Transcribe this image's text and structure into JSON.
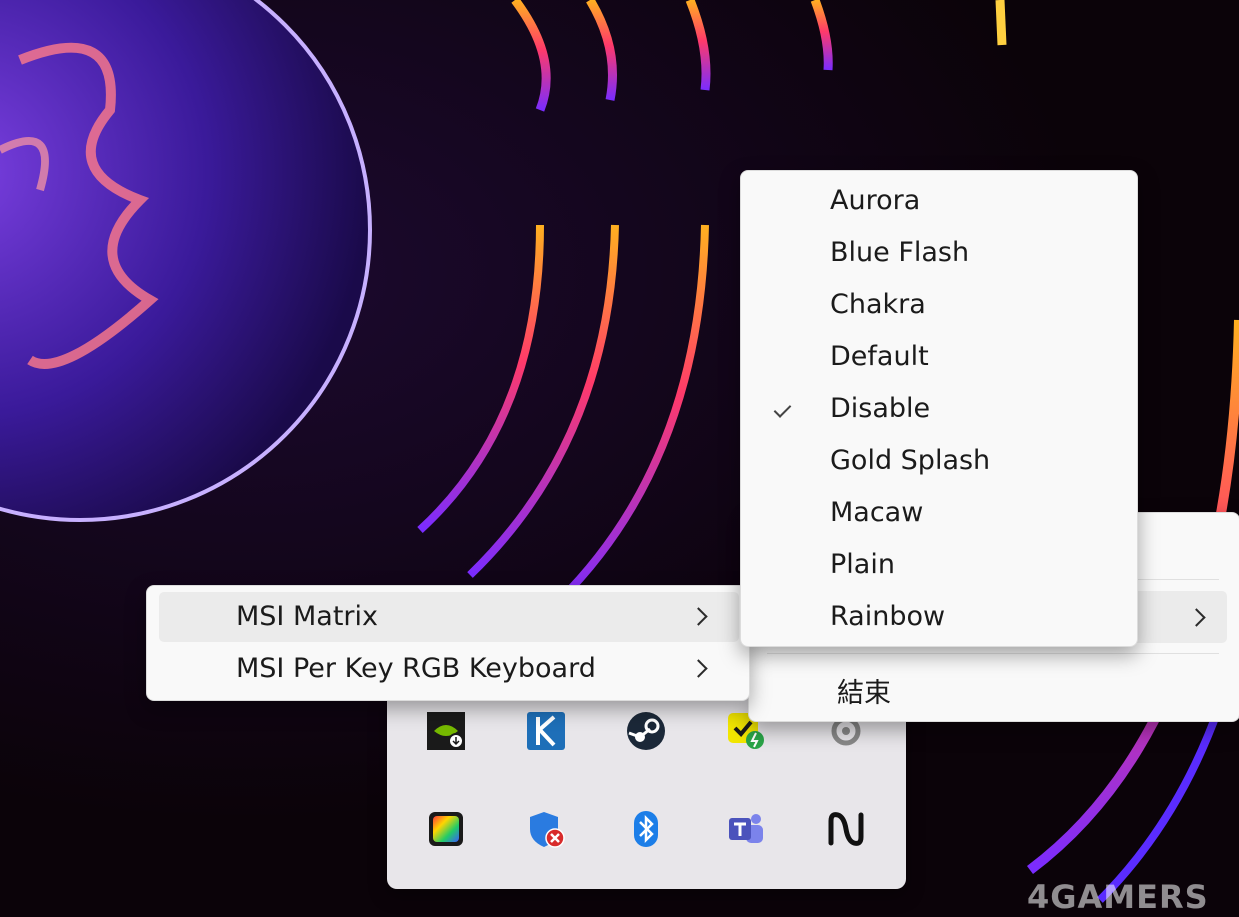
{
  "effects_menu": {
    "items": [
      {
        "label": "Aurora",
        "checked": false
      },
      {
        "label": "Blue Flash",
        "checked": false
      },
      {
        "label": "Chakra",
        "checked": false
      },
      {
        "label": "Default",
        "checked": false
      },
      {
        "label": "Disable",
        "checked": true
      },
      {
        "label": "Gold Splash",
        "checked": false
      },
      {
        "label": "Macaw",
        "checked": false
      },
      {
        "label": "Plain",
        "checked": false
      },
      {
        "label": "Rainbow",
        "checked": false
      }
    ]
  },
  "device_menu": {
    "items": [
      {
        "label": "MSI Matrix",
        "has_submenu": true,
        "highlighted": true
      },
      {
        "label": "MSI Per Key RGB Keyboard",
        "has_submenu": true,
        "highlighted": false
      }
    ]
  },
  "tray_menu": {
    "exit_label": "結束"
  },
  "tray_icons": [
    "nvidia-icon",
    "k-app-icon",
    "steam-icon",
    "task-charge-icon",
    "steelseries-icon",
    "color-palette-icon",
    "defender-warning-icon",
    "bluetooth-icon",
    "teams-icon",
    "wave-app-icon"
  ],
  "watermark": "4GAMERS",
  "colors": {
    "menu_bg": "#f9f9f9",
    "highlight": "#ebebeb",
    "text": "#1b1b1b"
  }
}
